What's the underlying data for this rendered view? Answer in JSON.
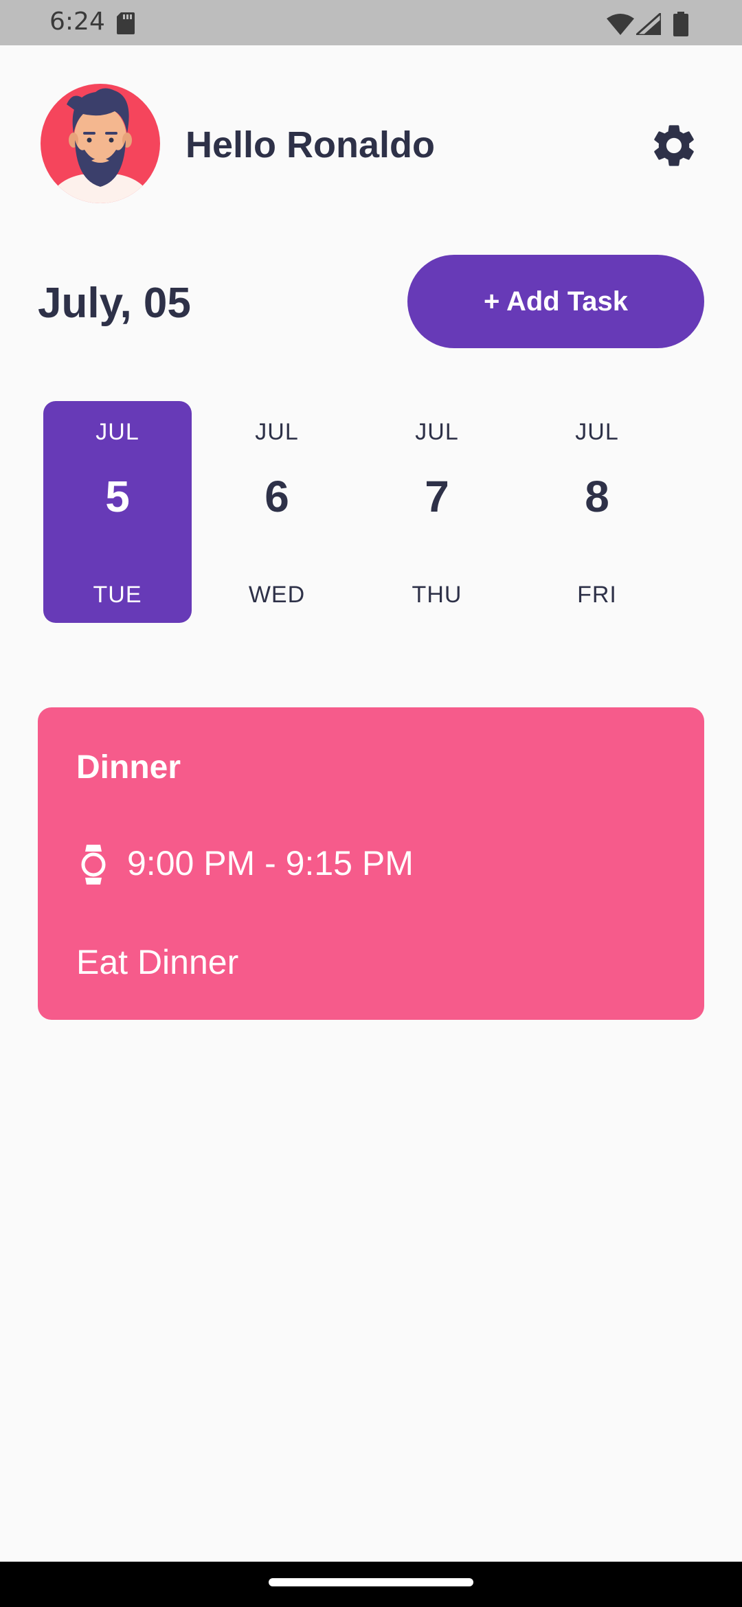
{
  "status_bar": {
    "time": "6:24",
    "icons": [
      "sd-card-icon",
      "wifi-icon",
      "signal-icon",
      "battery-icon"
    ]
  },
  "header": {
    "greeting": "Hello Ronaldo",
    "avatar_icon": "avatar-bearded-man",
    "settings_icon": "gear-icon"
  },
  "date_header": {
    "title": "July, 05",
    "add_button_label": "+ Add Task"
  },
  "date_picker": {
    "items": [
      {
        "month": "JUL",
        "day": "5",
        "weekday": "TUE",
        "selected": true
      },
      {
        "month": "JUL",
        "day": "6",
        "weekday": "WED",
        "selected": false
      },
      {
        "month": "JUL",
        "day": "7",
        "weekday": "THU",
        "selected": false
      },
      {
        "month": "JUL",
        "day": "8",
        "weekday": "FRI",
        "selected": false
      }
    ]
  },
  "tasks": [
    {
      "title": "Dinner",
      "time": "9:00 PM - 9:15 PM",
      "description": "Eat Dinner",
      "color": "#f65b8b",
      "time_icon": "watch-icon"
    }
  ],
  "colors": {
    "accent": "#673ab7",
    "text_dark": "#2e3148",
    "background": "#fafafa",
    "avatar_background": "#f5455c"
  }
}
